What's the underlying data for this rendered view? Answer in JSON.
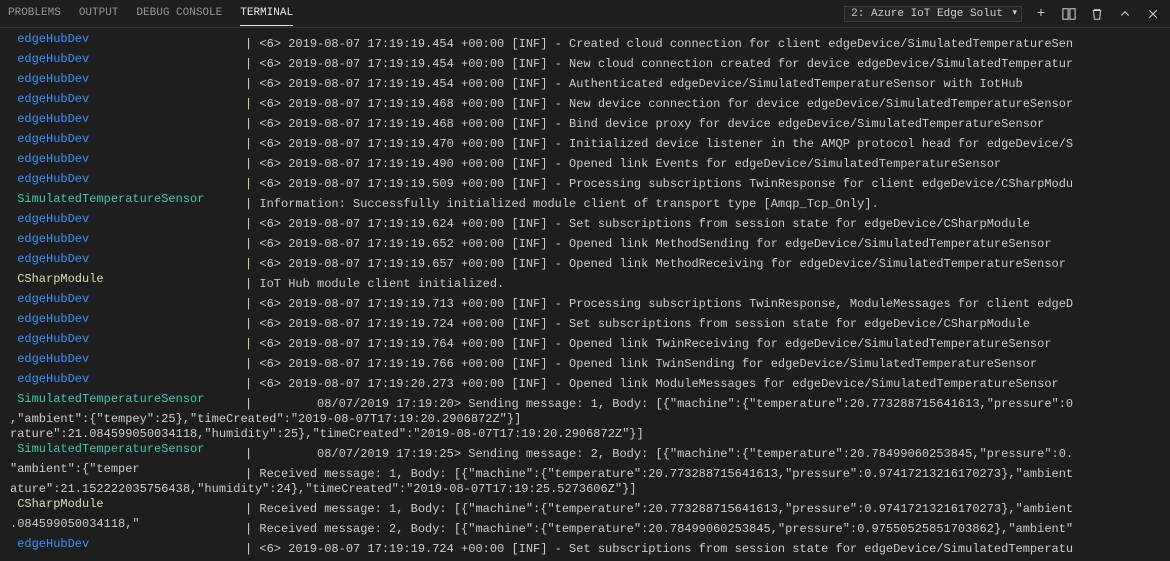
{
  "header": {
    "tabs": [
      "PROBLEMS",
      "OUTPUT",
      "DEBUG CONSOLE",
      "TERMINAL"
    ],
    "activeTab": 3,
    "dropdown": "2: Azure IoT Edge Solut"
  },
  "colors": {
    "blue": "#3794ff",
    "green": "#3dc9b0",
    "yellow": "#dcdcaa"
  },
  "lines": [
    {
      "src": "edgeHubDev",
      "cls": "src-blue",
      "sep": "|",
      "msg": " <6> 2019-08-07 17:19:19.454 +00:00 [INF] - Created cloud connection for client edgeDevice/SimulatedTemperatureSen"
    },
    {
      "src": "edgeHubDev",
      "cls": "src-blue",
      "sep": "|",
      "msg": " <6> 2019-08-07 17:19:19.454 +00:00 [INF] - New cloud connection created for device edgeDevice/SimulatedTemperatur"
    },
    {
      "src": "edgeHubDev",
      "cls": "src-blue",
      "sep": "|",
      "msg": " <6> 2019-08-07 17:19:19.454 +00:00 [INF] - Authenticated edgeDevice/SimulatedTemperatureSensor with IotHub"
    },
    {
      "src": "edgeHubDev",
      "cls": "src-blue",
      "sep": "|",
      "msg": " <6> 2019-08-07 17:19:19.468 +00:00 [INF] - New device connection for device edgeDevice/SimulatedTemperatureSensor"
    },
    {
      "src": "edgeHubDev",
      "cls": "src-blue",
      "sep": "|",
      "msg": " <6> 2019-08-07 17:19:19.468 +00:00 [INF] - Bind device proxy for device edgeDevice/SimulatedTemperatureSensor"
    },
    {
      "src": "edgeHubDev",
      "cls": "src-blue",
      "sep": "|",
      "msg": " <6> 2019-08-07 17:19:19.470 +00:00 [INF] - Initialized device listener in the AMQP protocol head for edgeDevice/S"
    },
    {
      "src": "edgeHubDev",
      "cls": "src-blue",
      "sep": "|",
      "msg": " <6> 2019-08-07 17:19:19.490 +00:00 [INF] - Opened link Events for edgeDevice/SimulatedTemperatureSensor"
    },
    {
      "src": "edgeHubDev",
      "cls": "src-blue",
      "sep": "|",
      "msg": " <6> 2019-08-07 17:19:19.509 +00:00 [INF] - Processing subscriptions TwinResponse for client edgeDevice/CSharpModu"
    },
    {
      "src": "SimulatedTemperatureSensor",
      "cls": "src-green",
      "sep": "|",
      "msg": " Information: Successfully initialized module client of transport type [Amqp_Tcp_Only]."
    },
    {
      "src": "edgeHubDev",
      "cls": "src-blue",
      "sep": "|",
      "msg": " <6> 2019-08-07 17:19:19.624 +00:00 [INF] - Set subscriptions from session state for edgeDevice/CSharpModule"
    },
    {
      "src": "edgeHubDev",
      "cls": "src-blue",
      "sep": "|",
      "msg": " <6> 2019-08-07 17:19:19.652 +00:00 [INF] - Opened link MethodSending for edgeDevice/SimulatedTemperatureSensor"
    },
    {
      "src": "edgeHubDev",
      "cls": "src-blue",
      "sep": "|",
      "msg": " <6> 2019-08-07 17:19:19.657 +00:00 [INF] - Opened link MethodReceiving for edgeDevice/SimulatedTemperatureSensor"
    },
    {
      "src": "CSharpModule",
      "cls": "src-yellow",
      "sep": "|",
      "msg": " IoT Hub module client initialized."
    },
    {
      "src": "edgeHubDev",
      "cls": "src-blue",
      "sep": "|",
      "msg": " <6> 2019-08-07 17:19:19.713 +00:00 [INF] - Processing subscriptions TwinResponse, ModuleMessages for client edgeD"
    },
    {
      "src": "edgeHubDev",
      "cls": "src-blue",
      "sep": "|",
      "msg": " <6> 2019-08-07 17:19:19.724 +00:00 [INF] - Set subscriptions from session state for edgeDevice/CSharpModule"
    },
    {
      "src": "edgeHubDev",
      "cls": "src-blue",
      "sep": "|",
      "msg": " <6> 2019-08-07 17:19:19.764 +00:00 [INF] - Opened link TwinReceiving for edgeDevice/SimulatedTemperatureSensor"
    },
    {
      "src": "edgeHubDev",
      "cls": "src-blue",
      "sep": "|",
      "msg": " <6> 2019-08-07 17:19:19.766 +00:00 [INF] - Opened link TwinSending for edgeDevice/SimulatedTemperatureSensor"
    },
    {
      "src": "edgeHubDev",
      "cls": "src-blue",
      "sep": "|",
      "msg": " <6> 2019-08-07 17:19:20.273 +00:00 [INF] - Opened link ModuleMessages for edgeDevice/SimulatedTemperatureSensor"
    },
    {
      "src": "SimulatedTemperatureSensor",
      "cls": "src-green",
      "sep": "|",
      "msg": "         08/07/2019 17:19:20> Sending message: 1, Body: [{\"machine\":{\"temperature\":20.773288715641613,\"pressure\":0"
    },
    {
      "raw": ",\"ambient\":{\"tempey\":25},\"timeCreated\":\"2019-08-07T17:19:20.2906872Z\"}]"
    },
    {
      "raw": "rature\":21.084599050034118,\"humidity\":25},\"timeCreated\":\"2019-08-07T17:19:20.2906872Z\"}]"
    },
    {
      "src": "SimulatedTemperatureSensor",
      "cls": "src-green",
      "sep": "|",
      "msg": "         08/07/2019 17:19:25> Sending message: 2, Body: [{\"machine\":{\"temperature\":20.78499060253845,\"pressure\":0."
    },
    {
      "raw": "\"ambient\":{\"temper     ",
      "sep": "|",
      "msg": " Received message: 1, Body: [{\"machine\":{\"temperature\":20.773288715641613,\"pressure\":0.97417213216170273},\"ambient"
    },
    {
      "raw": "ature\":21.152222035756438,\"humidity\":24},\"timeCreated\":\"2019-08-07T17:19:25.5273606Z\"}]"
    },
    {
      "src": "CSharpModule",
      "cls": "src-yellow",
      "sep": "|",
      "msg": " Received message: 1, Body: [{\"machine\":{\"temperature\":20.773288715641613,\"pressure\":0.97417213216170273},\"ambient"
    },
    {
      "raw": ".084599050034118,\"     ",
      "sep": "|",
      "msg": " Received message: 2, Body: [{\"machine\":{\"temperature\":20.78499060253845,\"pressure\":0.97550525851703862},\"ambient\""
    },
    {
      "src": "edgeHubDev",
      "cls": "src-blue",
      "sep": "|",
      "msg": " <6> 2019-08-07 17:19:19.724 +00:00 [INF] - Set subscriptions from session state for edgeDevice/SimulatedTemperatu"
    }
  ]
}
